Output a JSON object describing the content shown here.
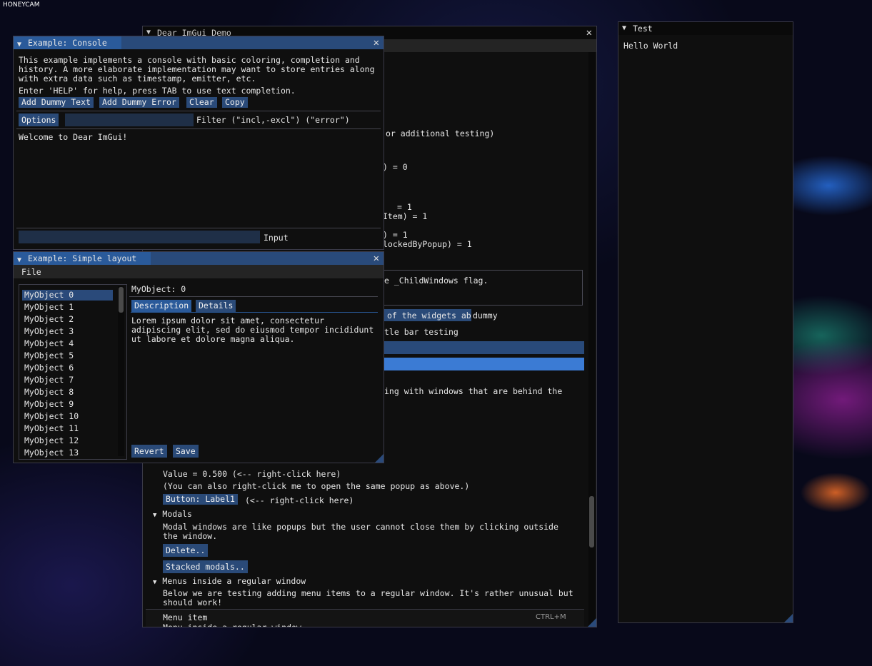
{
  "watermark": "HONEYCAM",
  "colors": {
    "title_active": "#294a7a",
    "button": "#2a4a78",
    "selected": "#3b7bd4",
    "window_bg": "#0f0f0f"
  },
  "demo": {
    "title": "Dear ImGui Demo",
    "lines": [
      "or additional testing)",
      ") = 0",
      "= 1",
      "Item) = 1",
      ") = 1",
      "lockedByPopup) = 1",
      "e _ChildWindows flag.",
      "of the widgets ab",
      "dummy",
      "tle bar testing",
      "ing with windows that are behind the"
    ],
    "context_value": "Value = 0.500 (<-- right-click here)",
    "context_hint": "(You can also right-click me to open the same popup as above.)",
    "label_button": "Button: Label1",
    "label_hint": "(<-- right-click here)",
    "modals_header": "Modals",
    "modals_desc_1": "Modal windows are like popups but the user cannot close them by clicking outside",
    "modals_desc_2": "the window.",
    "delete_button": "Delete..",
    "stacked_button": "Stacked modals..",
    "menus_header": "Menus inside a regular window",
    "menus_desc_1": "Below we are testing adding menu items to a regular window. It's rather unusual but",
    "menus_desc_2": "should work!",
    "menu_item": "Menu item",
    "menu_shortcut": "CTRL+M",
    "menu_last": "Menu inside a regular window"
  },
  "test": {
    "title": "Test",
    "text": "Hello World"
  },
  "console": {
    "title": "Example: Console",
    "desc_1": "This example implements a console with basic coloring, completion and",
    "desc_2": "history. A more elaborate implementation may want to store entries along",
    "desc_3": "with extra data such as timestamp, emitter, etc.",
    "help": "Enter 'HELP' for help, press TAB to use text completion.",
    "buttons": [
      "Add Dummy Text",
      "Add Dummy Error",
      "Clear",
      "Copy"
    ],
    "options_button": "Options",
    "filter_label": "Filter (\"incl,-excl\") (\"error\")",
    "log": "Welcome to Dear ImGui!",
    "input_label": "Input"
  },
  "layout": {
    "title": "Example: Simple layout",
    "menu_file": "File",
    "items": [
      "MyObject 0",
      "MyObject 1",
      "MyObject 2",
      "MyObject 3",
      "MyObject 4",
      "MyObject 5",
      "MyObject 6",
      "MyObject 7",
      "MyObject 8",
      "MyObject 9",
      "MyObject 10",
      "MyObject 11",
      "MyObject 12",
      "MyObject 13"
    ],
    "selected_index": 0,
    "detail_title": "MyObject: 0",
    "tab_description": "Description",
    "tab_details": "Details",
    "lorem_1": "Lorem ipsum dolor sit amet, consectetur",
    "lorem_2": "adipiscing elit, sed do eiusmod tempor incididunt",
    "lorem_3": "ut labore et dolore magna aliqua.",
    "revert_button": "Revert",
    "save_button": "Save"
  }
}
